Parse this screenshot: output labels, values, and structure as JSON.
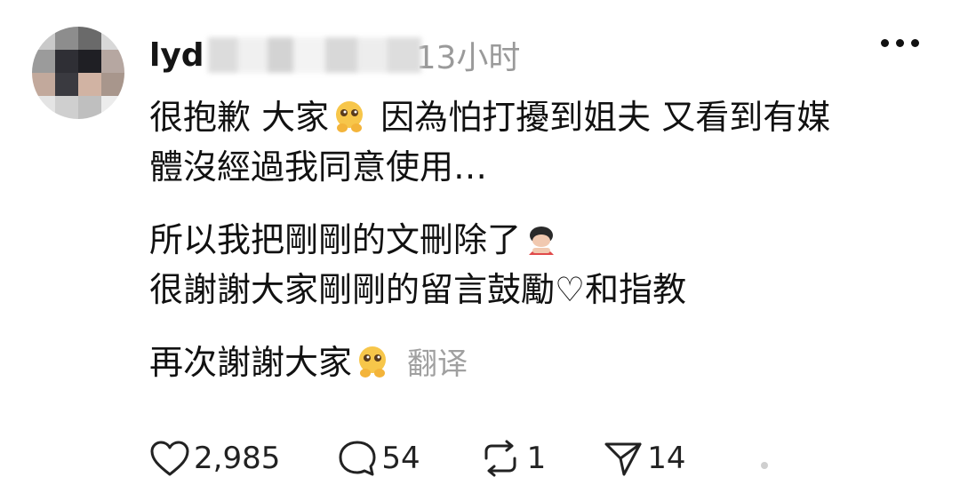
{
  "post": {
    "username_visible": "lyd",
    "time": "13小时",
    "lines": [
      {
        "before": "很抱歉 大家",
        "emoji": "pleading-hands-emoji",
        "after": " 因為怕打擾到姐夫 又看到有媒"
      },
      {
        "text": "體沒經過我同意使用…"
      },
      {
        "text": "所以我把剛剛的文刪除了",
        "emoji": "bowing-person-emoji"
      },
      {
        "text": "很謝謝大家剛剛的留言鼓勵♡和指教"
      },
      {
        "text": "再次謝謝大家",
        "emoji": "pleading-hands-emoji",
        "translate": "翻译"
      }
    ]
  },
  "actions": {
    "likes": "2,985",
    "comments": "54",
    "reposts": "1",
    "shares": "14"
  },
  "colors": {
    "text": "#111111",
    "muted": "#9a9a9a",
    "background": "#ffffff"
  }
}
